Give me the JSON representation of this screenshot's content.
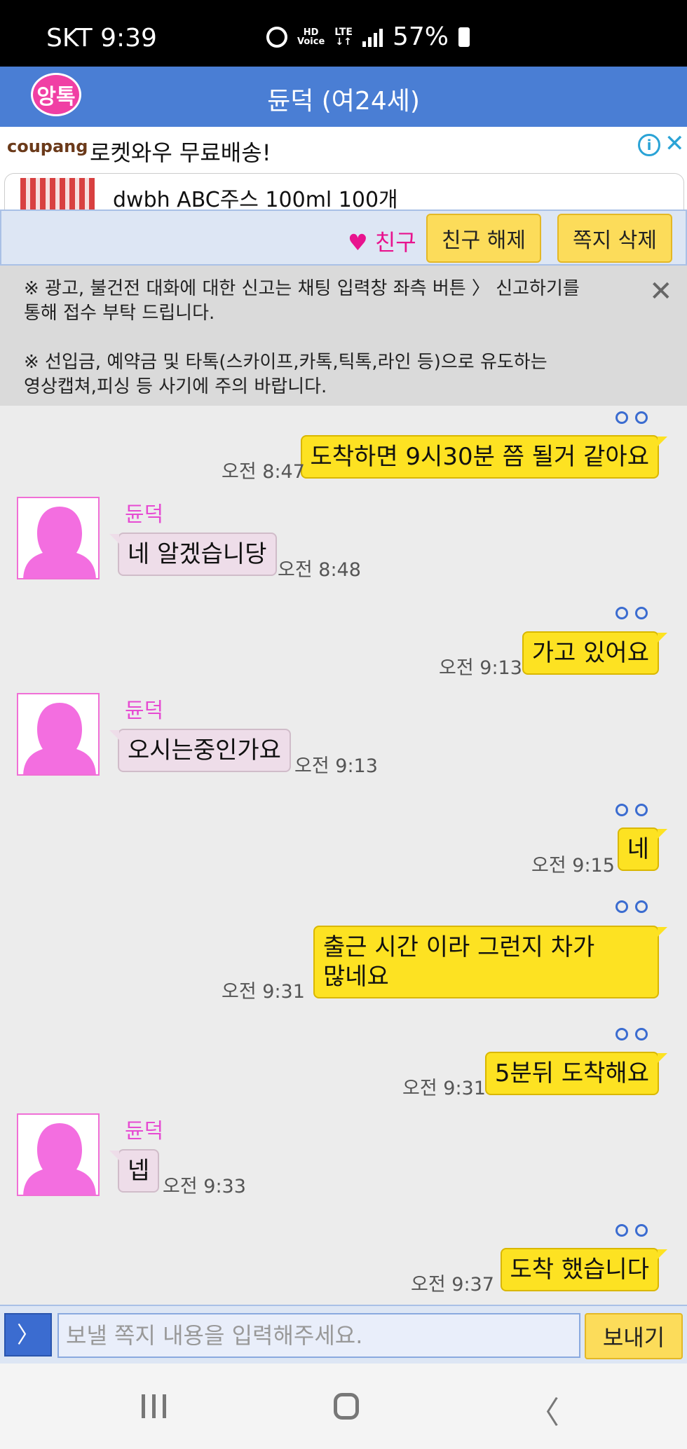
{
  "status_bar": {
    "carrier_time": "SKT 9:39",
    "hd_label": "HD",
    "voice_label": "Voice",
    "lte_label": "LTE",
    "battery": "57%"
  },
  "header": {
    "logo_text": "앙톡",
    "title": "듄덕 (여24세)"
  },
  "ad": {
    "brand": "coupang",
    "headline": "로켓와우 무료배송!",
    "product": "dwbh ABC주스 100ml 100개"
  },
  "actions": {
    "friend_status": "♥ 친구",
    "unfriend": "친구 해제",
    "delete": "쪽지 삭제"
  },
  "notice": {
    "text": "※ 광고, 불건전 대화에 대한 신고는 채팅 입력창 좌측 버튼 〉 신고하기를\n통해 접수 부탁 드립니다.\n\n※ 선입금, 예약금 및 타톡(스카이프,카톡,틱톡,라인 등)으로 유도하는\n영상캡쳐,피싱 등 사기에 주의 바랍니다."
  },
  "messages": [
    {
      "direction": "out",
      "text": "도착하면 9시30분 쯤 될거 같아요",
      "time": "오전 8:47"
    },
    {
      "direction": "in",
      "sender": "듄덕",
      "text": "네 알겠습니당",
      "time": "오전 8:48"
    },
    {
      "direction": "out",
      "text": "가고 있어요",
      "time": "오전 9:13"
    },
    {
      "direction": "in",
      "sender": "듄덕",
      "text": "오시는중인가요",
      "time": "오전 9:13"
    },
    {
      "direction": "out",
      "text": "네",
      "time": "오전 9:15"
    },
    {
      "direction": "out",
      "text": "출근 시간 이라 그런지 차가\n많네요",
      "time": "오전 9:31"
    },
    {
      "direction": "out",
      "text": "5분뒤 도착해요",
      "time": "오전 9:31"
    },
    {
      "direction": "in",
      "sender": "듄덕",
      "text": "넵",
      "time": "오전 9:33"
    },
    {
      "direction": "out",
      "text": "도착 했습니다",
      "time": "오전 9:37"
    }
  ],
  "input": {
    "menu_glyph": "〉",
    "placeholder": "보낼 쪽지 내용을 입력해주세요.",
    "send": "보내기"
  },
  "colors": {
    "header_blue": "#4a7ed4",
    "outgoing_bubble": "#fde222",
    "incoming_bubble": "#eedde9",
    "friend_pink": "#e8138e"
  }
}
